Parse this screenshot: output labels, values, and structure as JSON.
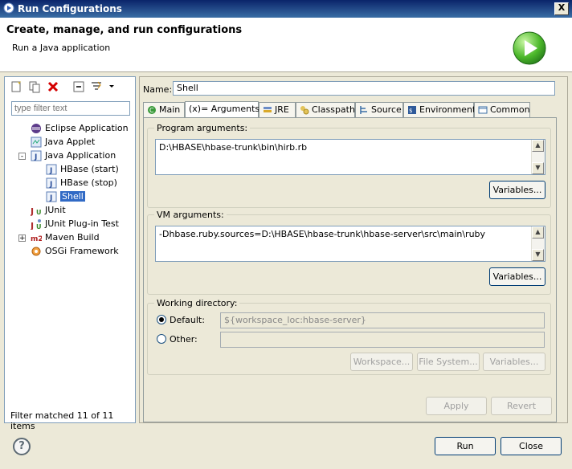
{
  "window": {
    "title": "Run Configurations",
    "close_label": "X"
  },
  "header": {
    "title": "Create, manage, and run configurations",
    "subtitle": "Run a Java application"
  },
  "left": {
    "filter_placeholder": "type filter text",
    "tree": [
      {
        "label": "Eclipse Application",
        "icon": "eclipse-icon"
      },
      {
        "label": "Java Applet",
        "icon": "applet-icon"
      },
      {
        "label": "Java Application",
        "icon": "java-app-icon",
        "expander": "-"
      },
      {
        "label": "HBase (start)",
        "icon": "java-config-icon"
      },
      {
        "label": "HBase (stop)",
        "icon": "java-config-icon"
      },
      {
        "label": "Shell",
        "icon": "java-config-icon",
        "selected": true
      },
      {
        "label": "JUnit",
        "icon": "junit-icon"
      },
      {
        "label": "JUnit Plug-in Test",
        "icon": "junit-plugin-icon"
      },
      {
        "label": "Maven Build",
        "icon": "maven-icon",
        "expander": "+"
      },
      {
        "label": "OSGi Framework",
        "icon": "osgi-icon"
      }
    ],
    "filter_status": "Filter matched 11 of 11 items"
  },
  "right": {
    "name_label": "Name:",
    "name_value": "Shell",
    "tabs": [
      {
        "label": "Main"
      },
      {
        "label": "(x)= Arguments",
        "active": true
      },
      {
        "label": "JRE"
      },
      {
        "label": "Classpath"
      },
      {
        "label": "Source"
      },
      {
        "label": "Environment"
      },
      {
        "label": "Common"
      }
    ],
    "program_args": {
      "title": "Program arguments:",
      "value": "D:\\HBASE\\hbase-trunk\\bin\\hirb.rb",
      "variables": "Variables..."
    },
    "vm_args": {
      "title": "VM arguments:",
      "value": "-Dhbase.ruby.sources=D:\\HBASE\\hbase-trunk\\hbase-server\\src\\main\\ruby",
      "variables": "Variables..."
    },
    "working_dir": {
      "title": "Working directory:",
      "default_label": "Default:",
      "default_value": "${workspace_loc:hbase-server}",
      "other_label": "Other:",
      "other_value": "",
      "workspace_btn": "Workspace...",
      "filesystem_btn": "File System...",
      "variables_btn": "Variables..."
    },
    "apply": "Apply",
    "revert": "Revert"
  },
  "footer": {
    "run": "Run",
    "close": "Close",
    "help": "?"
  }
}
